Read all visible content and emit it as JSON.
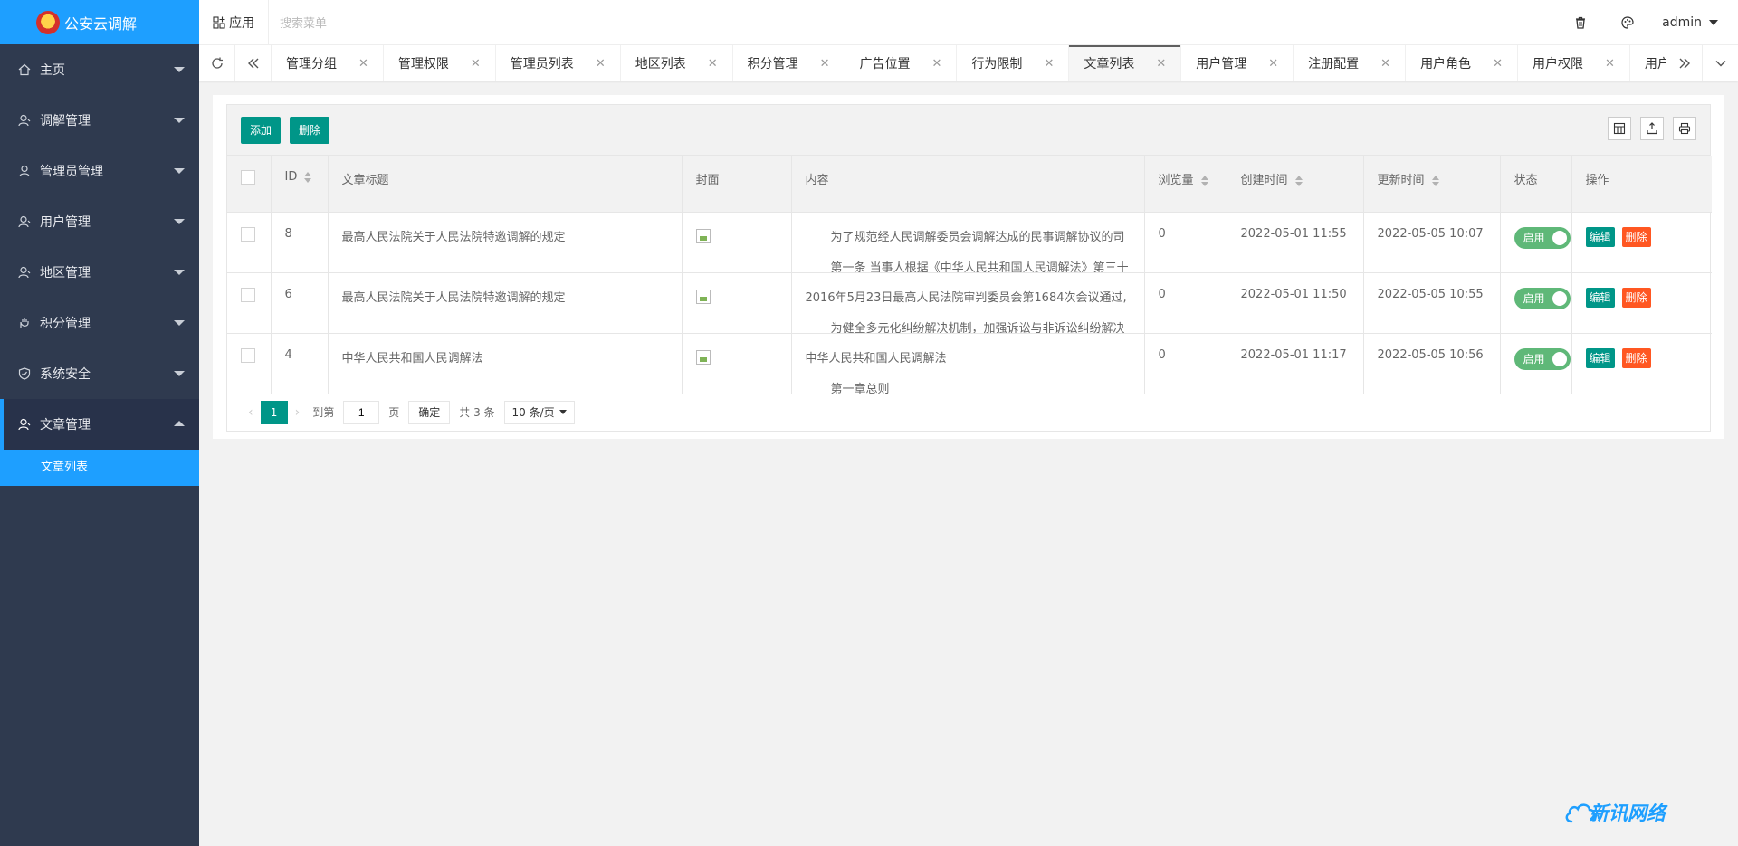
{
  "app": {
    "title": "公安云调解"
  },
  "sidebar": {
    "items": [
      {
        "label": "主页",
        "icon": "home-icon"
      },
      {
        "label": "调解管理",
        "icon": "user-icon"
      },
      {
        "label": "管理员管理",
        "icon": "user-icon"
      },
      {
        "label": "用户管理",
        "icon": "user-icon"
      },
      {
        "label": "地区管理",
        "icon": "user-icon"
      },
      {
        "label": "积分管理",
        "icon": "hand-icon"
      },
      {
        "label": "系统安全",
        "icon": "shield-icon"
      },
      {
        "label": "文章管理",
        "icon": "user-icon"
      }
    ],
    "subitems": [
      {
        "label": "文章列表"
      }
    ]
  },
  "header": {
    "app_label": "应用",
    "search_placeholder": "搜索菜单",
    "user": "admin"
  },
  "tabs": [
    {
      "label": "管理分组"
    },
    {
      "label": "管理权限"
    },
    {
      "label": "管理员列表"
    },
    {
      "label": "地区列表"
    },
    {
      "label": "积分管理"
    },
    {
      "label": "广告位置"
    },
    {
      "label": "行为限制"
    },
    {
      "label": "文章列表",
      "active": true
    },
    {
      "label": "用户管理"
    },
    {
      "label": "注册配置"
    },
    {
      "label": "用户角色"
    },
    {
      "label": "用户权限"
    },
    {
      "label": "用户日志"
    }
  ],
  "toolbar": {
    "add_label": "添加",
    "delete_label": "删除"
  },
  "table": {
    "headers": {
      "id": "ID",
      "title": "文章标题",
      "cover": "封面",
      "content": "内容",
      "views": "浏览量",
      "created": "创建时间",
      "updated": "更新时间",
      "status": "状态",
      "ops": "操作"
    },
    "rows": [
      {
        "id": "8",
        "title": "最高人民法院关于人民法院特邀调解的规定",
        "content_line1": "为了规范经人民调解委员会调解达成的民事调解协议的司",
        "content_line2": "第一条 当事人根据《中华人民共和国人民调解法》第三十",
        "indent1": true,
        "views": "0",
        "created": "2022-05-01 11:55",
        "updated": "2022-05-05 10:07",
        "status": "启用"
      },
      {
        "id": "6",
        "title": "最高人民法院关于人民法院特邀调解的规定",
        "content_line1": "2016年5月23日最高人民法院审判委员会第1684次会议通过,",
        "content_line2": "为健全多元化纠纷解决机制，加强诉讼与非诉讼纠纷解决",
        "indent1": false,
        "views": "0",
        "created": "2022-05-01 11:50",
        "updated": "2022-05-05 10:55",
        "status": "启用"
      },
      {
        "id": "4",
        "title": "中华人民共和国人民调解法",
        "content_line1": "中华人民共和国人民调解法",
        "content_line2": "第一章总则",
        "indent1": false,
        "views": "0",
        "created": "2022-05-01 11:17",
        "updated": "2022-05-05 10:56",
        "status": "启用"
      }
    ],
    "op_edit": "编辑",
    "op_delete": "删除"
  },
  "pager": {
    "current": "1",
    "goto_label": "到第",
    "page_input": "1",
    "page_label": "页",
    "confirm_label": "确定",
    "total_label": "共 3 条",
    "size_label": "10 条/页"
  },
  "brand": {
    "text": "新讯网络"
  },
  "colors": {
    "accent": "#1e9fff",
    "primary": "#009688",
    "danger": "#ff5722",
    "sidebar": "#2f3a4f",
    "switch_on": "#5fb878"
  }
}
